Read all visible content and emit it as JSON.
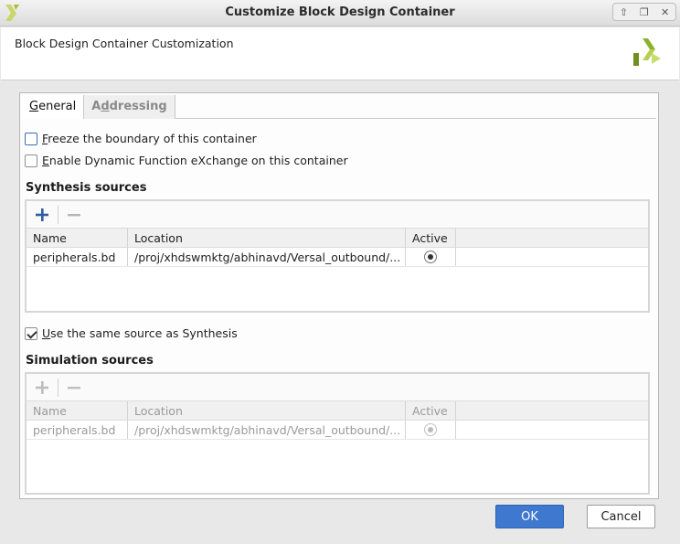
{
  "window": {
    "title": "Customize Block Design Container",
    "controls": {
      "up": "⇧",
      "restore": "❐",
      "close": "✕"
    }
  },
  "header": {
    "heading": "Block Design Container Customization"
  },
  "tabs": [
    {
      "label_u": "G",
      "label_rest": "eneral",
      "active": true
    },
    {
      "label_pre": "A",
      "label_u": "d",
      "label_rest": "dressing",
      "active": false
    }
  ],
  "options": {
    "freeze": {
      "u": "F",
      "rest": "reeze the boundary of this container",
      "checked": false
    },
    "dfx": {
      "u": "E",
      "rest": "nable Dynamic Function eXchange on this container",
      "checked": false
    },
    "same_source": {
      "u": "U",
      "rest": "se the same source as Synthesis",
      "checked": true
    }
  },
  "synthesis": {
    "title": "Synthesis sources",
    "columns": [
      "Name",
      "Location",
      "Active"
    ],
    "rows": [
      {
        "name": "peripherals.bd",
        "location": "/proj/xhdswmktg/abhinavd/Versal_outbound/..."
      }
    ]
  },
  "simulation": {
    "title": "Simulation sources",
    "columns": [
      "Name",
      "Location",
      "Active"
    ],
    "rows": [
      {
        "name": "peripherals.bd",
        "location": "/proj/xhdswmktg/abhinavd/Versal_outbound/..."
      }
    ]
  },
  "buttons": {
    "ok": "OK",
    "cancel": "Cancel"
  },
  "colors": {
    "accent": "#3f78cf",
    "logo_green": "#8ab22c"
  }
}
